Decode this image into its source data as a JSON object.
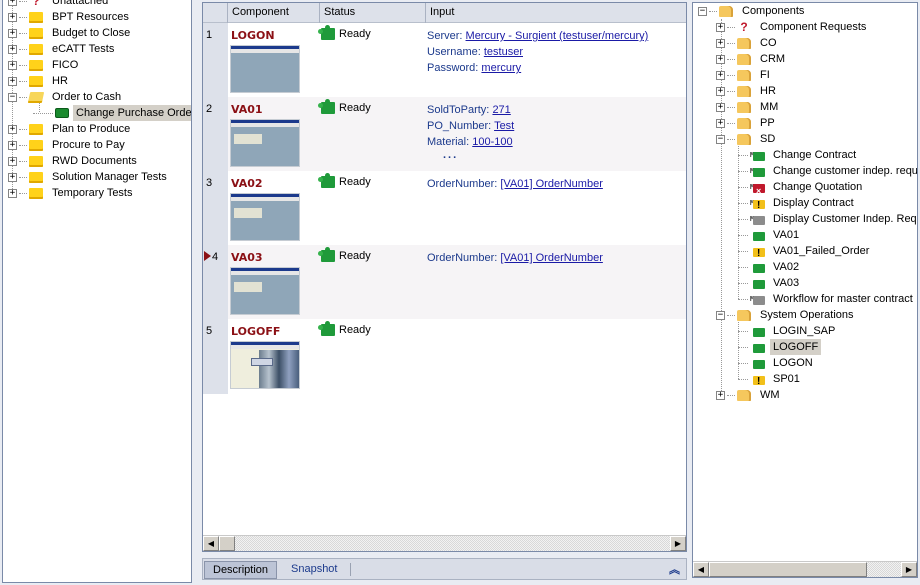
{
  "left_tree": {
    "items": [
      {
        "label": "Unattached",
        "icon": "question-icon",
        "expander": "+"
      },
      {
        "label": "BPT Resources",
        "icon": "folder-icon",
        "expander": "+"
      },
      {
        "label": "Budget to Close",
        "icon": "folder-icon",
        "expander": "+"
      },
      {
        "label": "eCATT Tests",
        "icon": "folder-icon",
        "expander": "+"
      },
      {
        "label": "FICO",
        "icon": "folder-icon",
        "expander": "+"
      },
      {
        "label": "HR",
        "icon": "folder-icon",
        "expander": "+"
      },
      {
        "label": "Order to Cash",
        "icon": "folder-open-icon",
        "expander": "-"
      },
      {
        "label": "Change Purchase Order",
        "icon": "business-process-icon",
        "selected": true
      },
      {
        "label": "Plan to Produce",
        "icon": "folder-icon",
        "expander": "+"
      },
      {
        "label": "Procure to Pay",
        "icon": "folder-icon",
        "expander": "+"
      },
      {
        "label": "RWD Documents",
        "icon": "folder-icon",
        "expander": "+"
      },
      {
        "label": "Solution Manager Tests",
        "icon": "folder-icon",
        "expander": "+"
      },
      {
        "label": "Temporary Tests",
        "icon": "folder-icon",
        "expander": "+"
      }
    ]
  },
  "grid": {
    "columns": [
      "Component",
      "Status",
      "Input"
    ],
    "rows": [
      {
        "num": "1",
        "name": "LOGON",
        "status": "Ready",
        "inputs": [
          {
            "key": "Server:",
            "value": "Mercury - Surgient (testuser/mercury)"
          },
          {
            "key": "Username:",
            "value": "testuser"
          },
          {
            "key": "Password:",
            "value": "mercury"
          }
        ]
      },
      {
        "num": "2",
        "name": "VA01",
        "status": "Ready",
        "inputs": [
          {
            "key": "SoldToParty:",
            "value": "271"
          },
          {
            "key": "PO_Number:",
            "value": "Test"
          },
          {
            "key": "Material:",
            "value": "100-100"
          }
        ],
        "more": "..."
      },
      {
        "num": "3",
        "name": "VA02",
        "status": "Ready",
        "inputs": [
          {
            "key": "OrderNumber:",
            "value": "[VA01] OrderNumber"
          }
        ]
      },
      {
        "num": "4",
        "name": "VA03",
        "status": "Ready",
        "current": true,
        "inputs": [
          {
            "key": "OrderNumber:",
            "value": "[VA01] OrderNumber"
          }
        ]
      },
      {
        "num": "5",
        "name": "LOGOFF",
        "status": "Ready",
        "inputs": []
      }
    ]
  },
  "bottom_tabs": {
    "tabs": [
      "Description",
      "Snapshot"
    ],
    "active": "Description",
    "collapse_glyph": "⌃⌃"
  },
  "right_tree": {
    "root": "Components",
    "items": [
      {
        "label": "Component Requests",
        "icon": "question-icon",
        "expander": "+",
        "level": 1
      },
      {
        "label": "CO",
        "icon": "folder-icon",
        "expander": "+",
        "level": 1
      },
      {
        "label": "CRM",
        "icon": "folder-icon",
        "expander": "+",
        "level": 1
      },
      {
        "label": "FI",
        "icon": "folder-icon",
        "expander": "+",
        "level": 1
      },
      {
        "label": "HR",
        "icon": "folder-icon",
        "expander": "+",
        "level": 1
      },
      {
        "label": "MM",
        "icon": "folder-icon",
        "expander": "+",
        "level": 1
      },
      {
        "label": "PP",
        "icon": "folder-icon",
        "expander": "+",
        "level": 1
      },
      {
        "label": "SD",
        "icon": "folder-icon",
        "expander": "-",
        "level": 1
      },
      {
        "label": "Change Contract",
        "icon": "manual-component-ready-icon",
        "level": 2
      },
      {
        "label": "Change customer indep. requi",
        "icon": "manual-component-ready-icon",
        "level": 2
      },
      {
        "label": "Change Quotation",
        "icon": "manual-component-error-icon",
        "level": 2
      },
      {
        "label": "Display Contract",
        "icon": "manual-component-warning-icon",
        "level": 2
      },
      {
        "label": "Display Customer Indep. Requ",
        "icon": "manual-component-disabled-icon",
        "level": 2
      },
      {
        "label": "VA01",
        "icon": "component-ready-icon",
        "level": 2
      },
      {
        "label": "VA01_Failed_Order",
        "icon": "component-warning-icon",
        "level": 2
      },
      {
        "label": "VA02",
        "icon": "component-ready-icon",
        "level": 2
      },
      {
        "label": "VA03",
        "icon": "component-ready-icon",
        "level": 2
      },
      {
        "label": "Workflow for master contract",
        "icon": "manual-component-disabled-icon",
        "level": 2
      },
      {
        "label": "System Operations",
        "icon": "folder-icon",
        "expander": "-",
        "level": 1
      },
      {
        "label": "LOGIN_SAP",
        "icon": "component-ready-icon",
        "level": 2
      },
      {
        "label": "LOGOFF",
        "icon": "component-ready-icon",
        "level": 2,
        "selected": true
      },
      {
        "label": "LOGON",
        "icon": "component-ready-icon",
        "level": 2
      },
      {
        "label": "SP01",
        "icon": "component-warning-icon",
        "level": 2
      },
      {
        "label": "WM",
        "icon": "folder-icon",
        "expander": "+",
        "level": 1
      }
    ]
  },
  "colors": {
    "component_name": "#8b1015",
    "link": "#1a1aa6",
    "input_key": "#1c3a8c",
    "ready_green": "#1f9a3a",
    "warning_yellow": "#f2c01a",
    "error_red": "#c0182c"
  }
}
